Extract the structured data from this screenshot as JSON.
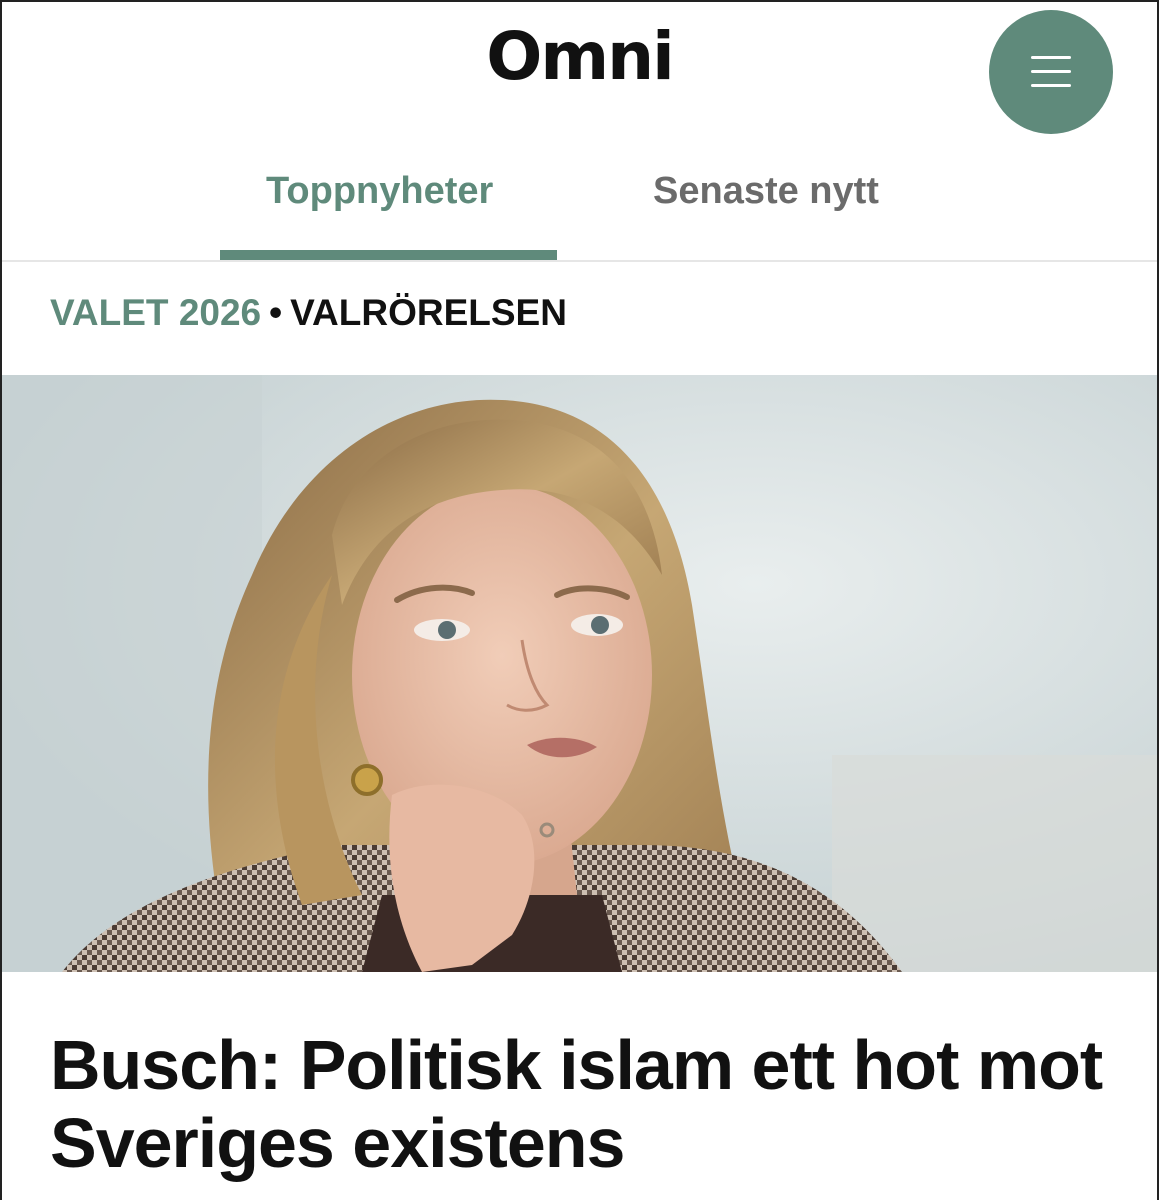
{
  "brand": {
    "logo_text": "Omni",
    "accent_color": "#5f8a7b"
  },
  "header": {
    "menu_icon": "hamburger-menu-icon"
  },
  "tabs": [
    {
      "label": "Toppnyheter",
      "active": true
    },
    {
      "label": "Senaste nytt",
      "active": false
    }
  ],
  "article": {
    "category": "VALET 2026",
    "separator": "•",
    "subcategory": "VALRÖRELSEN",
    "image_alt": "Porträtt av kvinna med handen mot hakan",
    "headline": "Busch: Politisk islam ett hot mot Sveriges existens"
  }
}
